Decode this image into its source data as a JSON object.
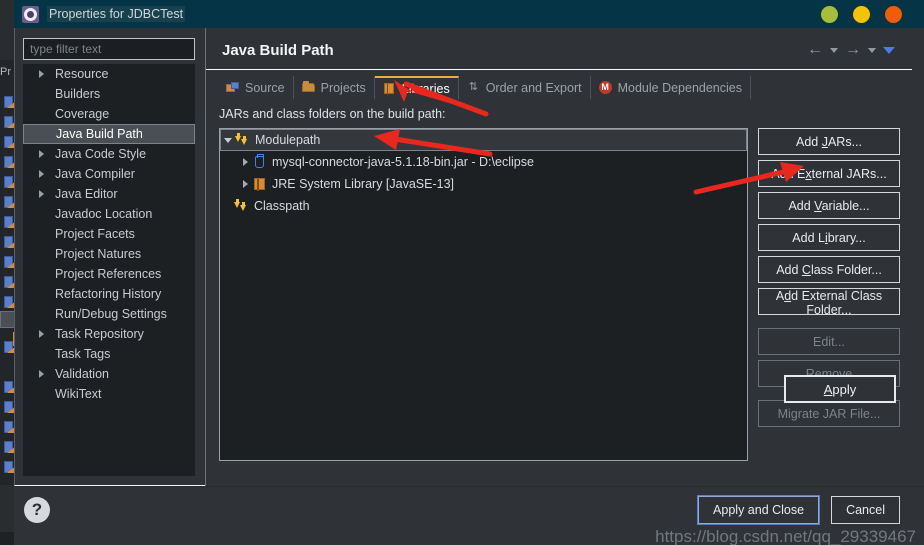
{
  "window": {
    "title": "Properties for JDBCTest",
    "icon": "settings-gear-icon",
    "controls": [
      {
        "name": "minimize",
        "color": "#a8bd3a"
      },
      {
        "name": "maximize",
        "color": "#f5c300"
      },
      {
        "name": "close",
        "color": "#f25c05"
      }
    ]
  },
  "filter": {
    "placeholder": "type filter text",
    "value": ""
  },
  "sidebar": {
    "items": [
      {
        "label": "Resource",
        "expandable": true,
        "selected": false
      },
      {
        "label": "Builders",
        "expandable": false,
        "selected": false
      },
      {
        "label": "Coverage",
        "expandable": false,
        "selected": false
      },
      {
        "label": "Java Build Path",
        "expandable": false,
        "selected": true
      },
      {
        "label": "Java Code Style",
        "expandable": true,
        "selected": false
      },
      {
        "label": "Java Compiler",
        "expandable": true,
        "selected": false
      },
      {
        "label": "Java Editor",
        "expandable": true,
        "selected": false
      },
      {
        "label": "Javadoc Location",
        "expandable": false,
        "selected": false
      },
      {
        "label": "Project Facets",
        "expandable": false,
        "selected": false
      },
      {
        "label": "Project Natures",
        "expandable": false,
        "selected": false
      },
      {
        "label": "Project References",
        "expandable": false,
        "selected": false
      },
      {
        "label": "Refactoring History",
        "expandable": false,
        "selected": false
      },
      {
        "label": "Run/Debug Settings",
        "expandable": false,
        "selected": false
      },
      {
        "label": "Task Repository",
        "expandable": true,
        "selected": false
      },
      {
        "label": "Task Tags",
        "expandable": false,
        "selected": false
      },
      {
        "label": "Validation",
        "expandable": true,
        "selected": false
      },
      {
        "label": "WikiText",
        "expandable": false,
        "selected": false
      }
    ]
  },
  "page": {
    "title": "Java Build Path",
    "nav": {
      "back_icon": "arrow-left-icon",
      "back_caret_icon": "chevron-down-icon",
      "forward_icon": "arrow-right-icon",
      "forward_caret_icon": "chevron-down-icon",
      "menu_icon": "triangle-down-icon"
    }
  },
  "tabs": [
    {
      "label": "Source",
      "icon": "source-folders-icon",
      "active": false
    },
    {
      "label": "Projects",
      "icon": "folder-icon",
      "active": false
    },
    {
      "label": "Libraries",
      "icon": "library-book-icon",
      "active": true
    },
    {
      "label": "Order and Export",
      "icon": "order-arrows-icon",
      "active": false
    },
    {
      "label": "Module Dependencies",
      "icon": "module-m-icon",
      "active": false
    }
  ],
  "libraries": {
    "caption": "JARs and class folders on the build path:",
    "tree": [
      {
        "label": "Modulepath",
        "icon": "classpath-arrows-icon",
        "level": 0,
        "twisty": "down",
        "selected": true
      },
      {
        "label": "mysql-connector-java-5.1.18-bin.jar - D:\\eclipse",
        "icon": "jar-icon",
        "level": 1,
        "twisty": "right",
        "selected": false
      },
      {
        "label": "JRE System Library [JavaSE-13]",
        "icon": "jre-library-icon",
        "level": 1,
        "twisty": "right",
        "selected": false
      },
      {
        "label": "Classpath",
        "icon": "classpath-arrows-icon",
        "level": 0,
        "twisty": "none",
        "selected": false
      }
    ]
  },
  "side_buttons": [
    {
      "label": "Add JARs...",
      "mnemonic": "J",
      "enabled": true,
      "gap": false
    },
    {
      "label": "Add External JARs...",
      "mnemonic": "x",
      "enabled": true,
      "gap": false
    },
    {
      "label": "Add Variable...",
      "mnemonic": "V",
      "enabled": true,
      "gap": false
    },
    {
      "label": "Add Library...",
      "mnemonic": "i",
      "enabled": true,
      "gap": false
    },
    {
      "label": "Add Class Folder...",
      "mnemonic": "C",
      "enabled": true,
      "gap": false
    },
    {
      "label": "Add External Class Folder...",
      "mnemonic": "d",
      "enabled": true,
      "gap": false
    },
    {
      "label": "Edit...",
      "mnemonic": "",
      "enabled": false,
      "gap": true
    },
    {
      "label": "Remove",
      "mnemonic": "",
      "enabled": false,
      "gap": false
    },
    {
      "label": "Migrate JAR File...",
      "mnemonic": "",
      "enabled": false,
      "gap": true
    }
  ],
  "apply_button": {
    "label": "Apply",
    "mnemonic": "A"
  },
  "footer": {
    "help_icon": "question-mark-icon",
    "apply_and_close": "Apply and Close",
    "cancel": "Cancel"
  },
  "watermark": "https://blog.csdn.net/qq_29339467",
  "annotations": [
    {
      "name": "arrow-to-libraries-tab",
      "color": "#e8281e"
    },
    {
      "name": "arrow-to-modulepath-row",
      "color": "#e8281e"
    },
    {
      "name": "arrow-to-add-external-jars",
      "color": "#e8281e"
    }
  ],
  "background": {
    "label_fragment": "Pr"
  }
}
